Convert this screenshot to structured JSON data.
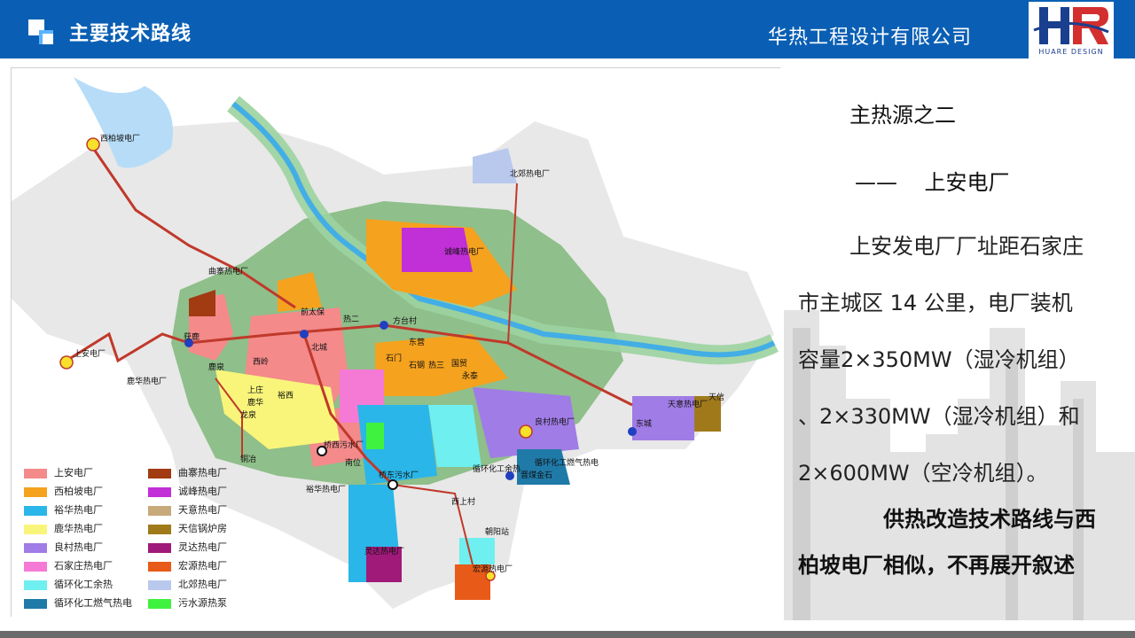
{
  "header": {
    "title": "主要技术路线",
    "company": "华热工程设计有限公司",
    "brand_text": "HUARE DESIGN",
    "color": "#0a5fb4"
  },
  "map": {
    "plant_labels": [
      "西柏坡电厂",
      "曲寨热电厂",
      "上安电厂",
      "鹿华热电厂",
      "北郊热电厂",
      "诚峰热电厂",
      "良村热电厂",
      "天意热电厂",
      "天信",
      "循环化工燃气热电",
      "循环化工余热",
      "裕华热电厂",
      "灵达热电厂",
      "宏源热电厂",
      "朝阳站",
      "晋煤金石",
      "西上村",
      "桥东污水厂",
      "桥西污水厂",
      "东城"
    ],
    "station_labels": [
      "鹿泉",
      "西岭",
      "获鹿",
      "北城",
      "前太保",
      "热二",
      "方台村",
      "东营",
      "石门",
      "石钢",
      "热三",
      "国贸",
      "永泰",
      "鹿华",
      "龙泉",
      "上庄",
      "铜冶",
      "南位",
      "裕西"
    ]
  },
  "legend": [
    {
      "label": "上安电厂",
      "color": "#f48a8a"
    },
    {
      "label": "西柏坡电厂",
      "color": "#f5a21f"
    },
    {
      "label": "裕华热电厂",
      "color": "#2ab6e8"
    },
    {
      "label": "鹿华热电厂",
      "color": "#f9f57a"
    },
    {
      "label": "良村热电厂",
      "color": "#a07ce6"
    },
    {
      "label": "石家庄热电厂",
      "color": "#f47ad6"
    },
    {
      "label": "循环化工余热",
      "color": "#6fefef"
    },
    {
      "label": "循环化工燃气热电",
      "color": "#1f7aa8"
    },
    {
      "label": "曲寨热电厂",
      "color": "#a23a12"
    },
    {
      "label": "诚峰热电厂",
      "color": "#c12fd6"
    },
    {
      "label": "天意热电厂",
      "color": "#c8a97a"
    },
    {
      "label": "天信锅炉房",
      "color": "#a07a1a"
    },
    {
      "label": "灵达热电厂",
      "color": "#a01a7a"
    },
    {
      "label": "宏源热电厂",
      "color": "#e85a18"
    },
    {
      "label": "北郊热电厂",
      "color": "#b9c9ee"
    },
    {
      "label": "污水源热泵",
      "color": "#3ff23f"
    }
  ],
  "panel": {
    "heat_title": "主热源之二",
    "heat_name": "——    上安电厂",
    "para_lines": [
      "上安发电厂厂址距石家庄",
      "市主城区 14 公里，电厂装机",
      "容量2×350MW（湿冷机组）",
      "、2×330MW（湿冷机组）和",
      "2×600MW（空冷机组）。"
    ],
    "note_lines": [
      "供热改造技术路线与西",
      "柏坡电厂相似，不再展开叙述"
    ]
  }
}
